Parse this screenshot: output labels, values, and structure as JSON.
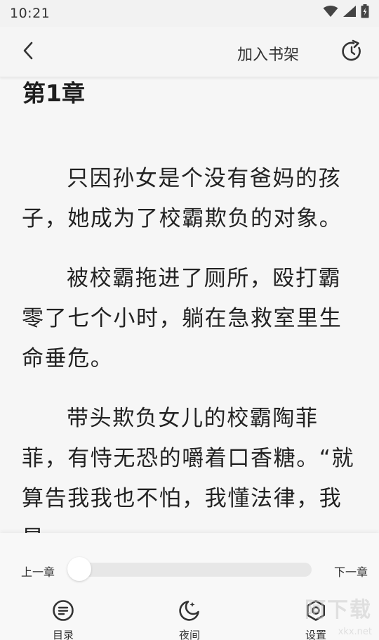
{
  "status_bar": {
    "time": "10:21",
    "icons": [
      "wifi-icon",
      "signal-icon",
      "battery-icon"
    ]
  },
  "toolbar": {
    "back_icon": "chevron-left-icon",
    "add_to_shelf_label": "加入书架",
    "refresh_icon": "refresh-icon"
  },
  "chapter": {
    "title": "第1章",
    "paragraphs": [
      "只因孙女是个没有爸妈的孩子，她成为了校霸欺负的对象。",
      "被校霸拖进了厕所，殴打霸零了七个小时，躺在急救室里生命垂危。",
      "带头欺负女儿的校霸陶菲菲，有恃无恐的嚼着口香糖。“就算告我我也不怕，我懂法律，我是"
    ]
  },
  "progress": {
    "prev_label": "上一章",
    "next_label": "下一章",
    "value": 0.0
  },
  "bottom_nav": {
    "toc_label": "目录",
    "night_label": "夜间",
    "settings_label": "设置"
  },
  "watermark": {
    "text": "阿下载",
    "sub": "xkx.net"
  },
  "colors": {
    "background": "#f6f6f6",
    "text": "#222222",
    "track": "#e7e7e7",
    "thumb": "#ffffff"
  }
}
